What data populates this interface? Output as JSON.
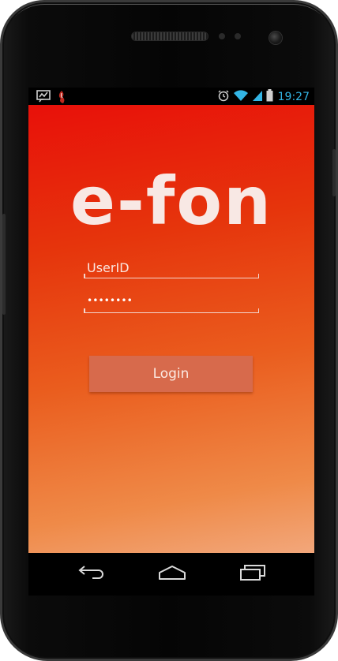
{
  "device": {
    "frame_color": "#050505",
    "bezel_color": "#3a3a3a"
  },
  "status_bar": {
    "left_icons": [
      "chat-notification-icon",
      "app-notification-icon"
    ],
    "right_icons": [
      "alarm-icon",
      "wifi-icon",
      "signal-icon",
      "battery-icon"
    ],
    "time": "19:27",
    "accent_color": "#33b5e5"
  },
  "app": {
    "logo_text": "e-fon",
    "userid_field": {
      "value": "",
      "placeholder": "UserID"
    },
    "password_field": {
      "masked_value": "••••••••"
    },
    "login_button_label": "Login",
    "gradient_colors": [
      "#e8100a",
      "#ea5d1e",
      "#f2a77b"
    ]
  },
  "nav_bar": {
    "buttons": [
      "back-icon",
      "home-icon",
      "recent-apps-icon"
    ]
  }
}
